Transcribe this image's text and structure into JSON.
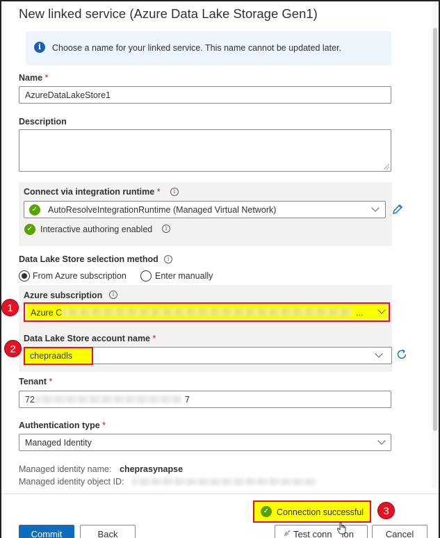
{
  "title": "New linked service (Azure Data Lake Storage Gen1)",
  "info_bar": {
    "text": "Choose a name for your linked service. This name cannot be updated later."
  },
  "name": {
    "label": "Name",
    "required_mark": "*",
    "value": "AzureDataLakeStore1"
  },
  "description": {
    "label": "Description",
    "value": ""
  },
  "runtime": {
    "label": "Connect via integration runtime",
    "required_mark": "*",
    "value": "AutoResolveIntegrationRuntime (Managed Virtual Network)",
    "status": "Interactive authoring enabled"
  },
  "selection_method": {
    "label": "Data Lake Store selection method",
    "options": [
      "From Azure subscription",
      "Enter manually"
    ],
    "selected": "From Azure subscription"
  },
  "subscription": {
    "label": "Azure subscription",
    "value_prefix": "Azure C",
    "value_suffix": "..."
  },
  "account": {
    "label": "Data Lake Store account name",
    "required_mark": "*",
    "value": "chepraadls"
  },
  "tenant": {
    "label": "Tenant",
    "required_mark": "*",
    "value_prefix": "72",
    "value_suffix": "7"
  },
  "auth": {
    "label": "Authentication type",
    "required_mark": "*",
    "value": "Managed Identity"
  },
  "managed_identity": {
    "name_label": "Managed identity name:",
    "name_value": "cheprasynapse",
    "object_id_label": "Managed identity object ID:"
  },
  "connection": {
    "status_text": "Connection successful"
  },
  "callouts": [
    "1",
    "2",
    "3"
  ],
  "footer": {
    "commit_label": "Commit",
    "back_label": "Back",
    "test_label_left": "Test conn",
    "test_label_right": "ion",
    "cancel_label": "Cancel"
  },
  "colors": {
    "accent": "#0f6cbd",
    "success": "#57a300",
    "highlight": "#ffff00",
    "callout": "#e81123"
  },
  "icons": [
    "info-icon",
    "check-circle-icon",
    "pencil-icon",
    "refresh-icon",
    "chevron-down-icon",
    "plug-icon",
    "hand-cursor-icon"
  ]
}
